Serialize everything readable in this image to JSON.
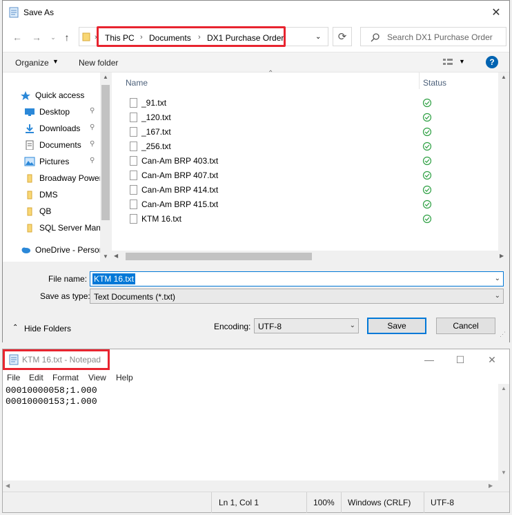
{
  "save_dialog": {
    "title": "Save As",
    "breadcrumb": [
      "This PC",
      "Documents",
      "DX1 Purchase Order"
    ],
    "search_placeholder": "Search DX1 Purchase Order",
    "toolbar": {
      "organize": "Organize",
      "new_folder": "New folder"
    },
    "columns": {
      "name": "Name",
      "status": "Status"
    },
    "nav_items": [
      {
        "label": "Quick access",
        "icon": "star-icon",
        "pinned": false
      },
      {
        "label": "Desktop",
        "icon": "desktop-icon",
        "pinned": true
      },
      {
        "label": "Downloads",
        "icon": "download-icon",
        "pinned": true
      },
      {
        "label": "Documents",
        "icon": "documents-icon",
        "pinned": true
      },
      {
        "label": "Pictures",
        "icon": "pictures-icon",
        "pinned": true
      },
      {
        "label": "Broadway Power",
        "icon": "folder-icon",
        "pinned": false
      },
      {
        "label": "DMS",
        "icon": "folder-icon",
        "pinned": false
      },
      {
        "label": "QB",
        "icon": "folder-icon",
        "pinned": false
      },
      {
        "label": "SQL Server Mana",
        "icon": "folder-icon",
        "pinned": false
      },
      {
        "label": "OneDrive - Person",
        "icon": "cloud-icon",
        "pinned": false
      }
    ],
    "files": [
      "_91.txt",
      "_120.txt",
      "_167.txt",
      "_256.txt",
      "Can-Am BRP 403.txt",
      "Can-Am BRP 407.txt",
      "Can-Am BRP 414.txt",
      "Can-Am BRP 415.txt",
      "KTM 16.txt"
    ],
    "file_name_label": "File name:",
    "file_name_value": "KTM 16.txt",
    "save_type_label": "Save as type:",
    "save_type_value": "Text Documents (*.txt)",
    "hide_folders": "Hide Folders",
    "encoding_label": "Encoding:",
    "encoding_value": "UTF-8",
    "save_button": "Save",
    "cancel_button": "Cancel"
  },
  "notepad": {
    "title": "KTM 16.txt - Notepad",
    "menu": [
      "File",
      "Edit",
      "Format",
      "View",
      "Help"
    ],
    "text": "00010000058;1.000\n00010000153;1.000",
    "status": {
      "position": "Ln 1, Col 1",
      "zoom": "100%",
      "line_ending": "Windows (CRLF)",
      "encoding": "UTF-8"
    }
  },
  "colors": {
    "highlight": "#e8242f",
    "accent": "#0078d7",
    "status_ok": "#2ea043"
  }
}
